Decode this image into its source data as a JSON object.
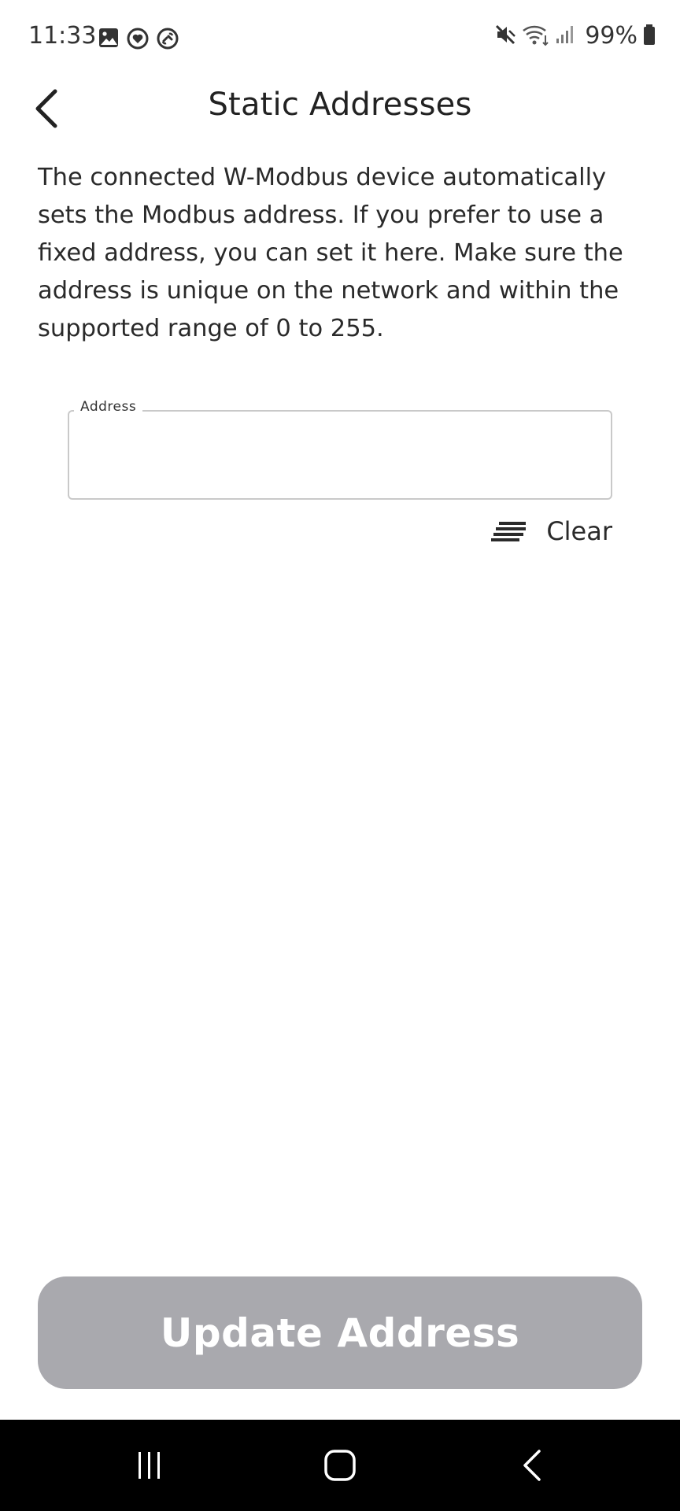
{
  "status_bar": {
    "time": "11:33",
    "battery": "99%",
    "left_icons": [
      "gallery-icon",
      "heart-badge-icon",
      "link-icon"
    ],
    "right_icons": [
      "mute-icon",
      "wifi-icon",
      "signal-icon",
      "battery-icon"
    ]
  },
  "header": {
    "title": "Static Addresses",
    "back_icon": "chevron-left-icon"
  },
  "description": "The connected W-Modbus device automatically sets the Modbus address. If you prefer to use a fixed address, you can set it here. Make sure the address is unique on the network and within the supported range of 0 to 255.",
  "address_field": {
    "label": "Address",
    "value": ""
  },
  "clear_button": {
    "label": "Clear",
    "icon": "clear-lines-icon"
  },
  "update_button": {
    "label": "Update Address",
    "enabled": false
  },
  "nav_bar": {
    "items": [
      "recents-icon",
      "home-icon",
      "back-icon"
    ]
  },
  "colors": {
    "button_disabled": "#a9a9ae",
    "text": "#222222",
    "field_border": "#c9c9c9",
    "nav_bg": "#000000"
  }
}
